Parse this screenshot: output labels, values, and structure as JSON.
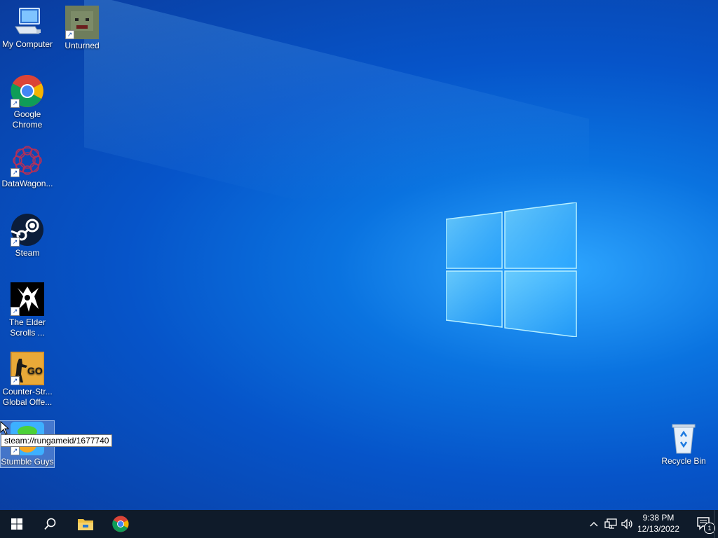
{
  "desktop": {
    "icons": [
      {
        "label": "My Computer"
      },
      {
        "label": "Unturned"
      },
      {
        "label": "Google Chrome"
      },
      {
        "label": "DataWagon..."
      },
      {
        "label": "Steam"
      },
      {
        "label": "The Elder Scrolls ..."
      },
      {
        "label": "Counter-Str... Global Offe..."
      },
      {
        "label": "Stumble Guys"
      },
      {
        "label": "Recycle Bin"
      }
    ],
    "tooltip": "steam://rungameid/1677740"
  },
  "taskbar": {
    "clock_time": "9:38 PM",
    "clock_date": "12/13/2022",
    "notification_count": "1"
  }
}
